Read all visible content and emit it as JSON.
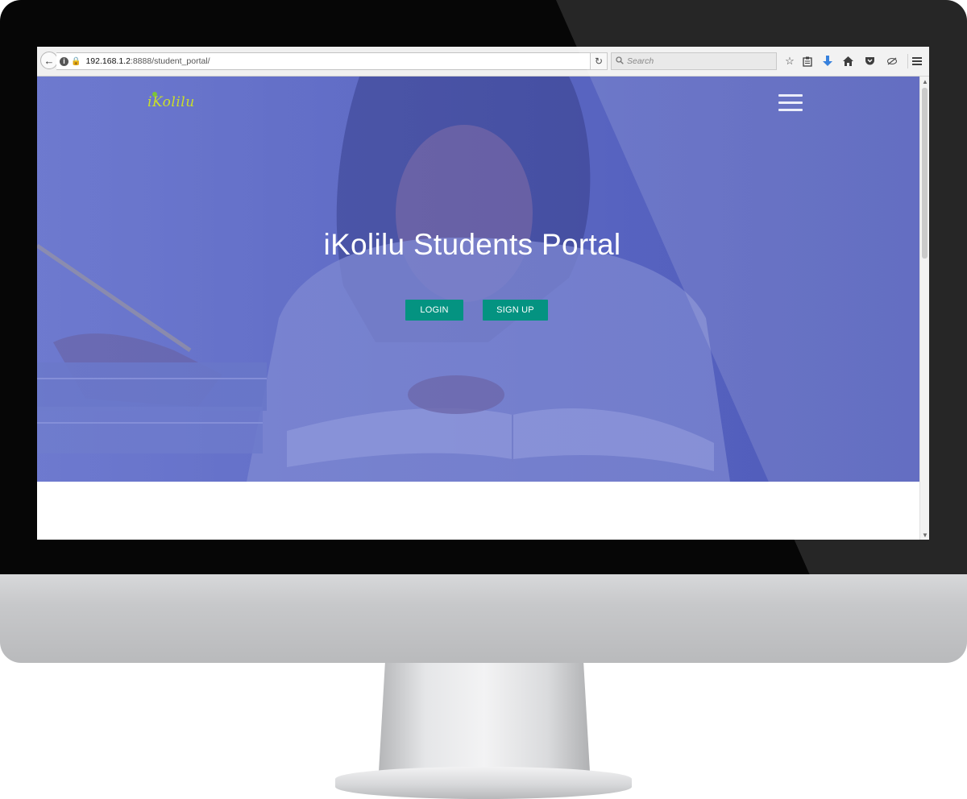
{
  "browser": {
    "url_host": "192.168.1.2",
    "url_path": ":8888/student_portal/",
    "search_placeholder": "Search",
    "icons": [
      "back-arrow-icon",
      "info-icon",
      "insecure-lock-icon",
      "dropdown-icon",
      "reload-icon",
      "search-icon",
      "bookmark-star-icon",
      "reading-list-icon",
      "download-icon",
      "home-icon",
      "pocket-icon",
      "extension-icon",
      "menu-icon"
    ],
    "accent_download": "#1a6fd8"
  },
  "site": {
    "logo_text": "iKolilu",
    "title": "iKolilu Students Portal",
    "buttons": {
      "login": "LOGIN",
      "signup": "SIGN UP"
    },
    "colors": {
      "hero_overlay": "#5a68c6",
      "button": "#049381",
      "logo": "#c9df2a"
    }
  }
}
